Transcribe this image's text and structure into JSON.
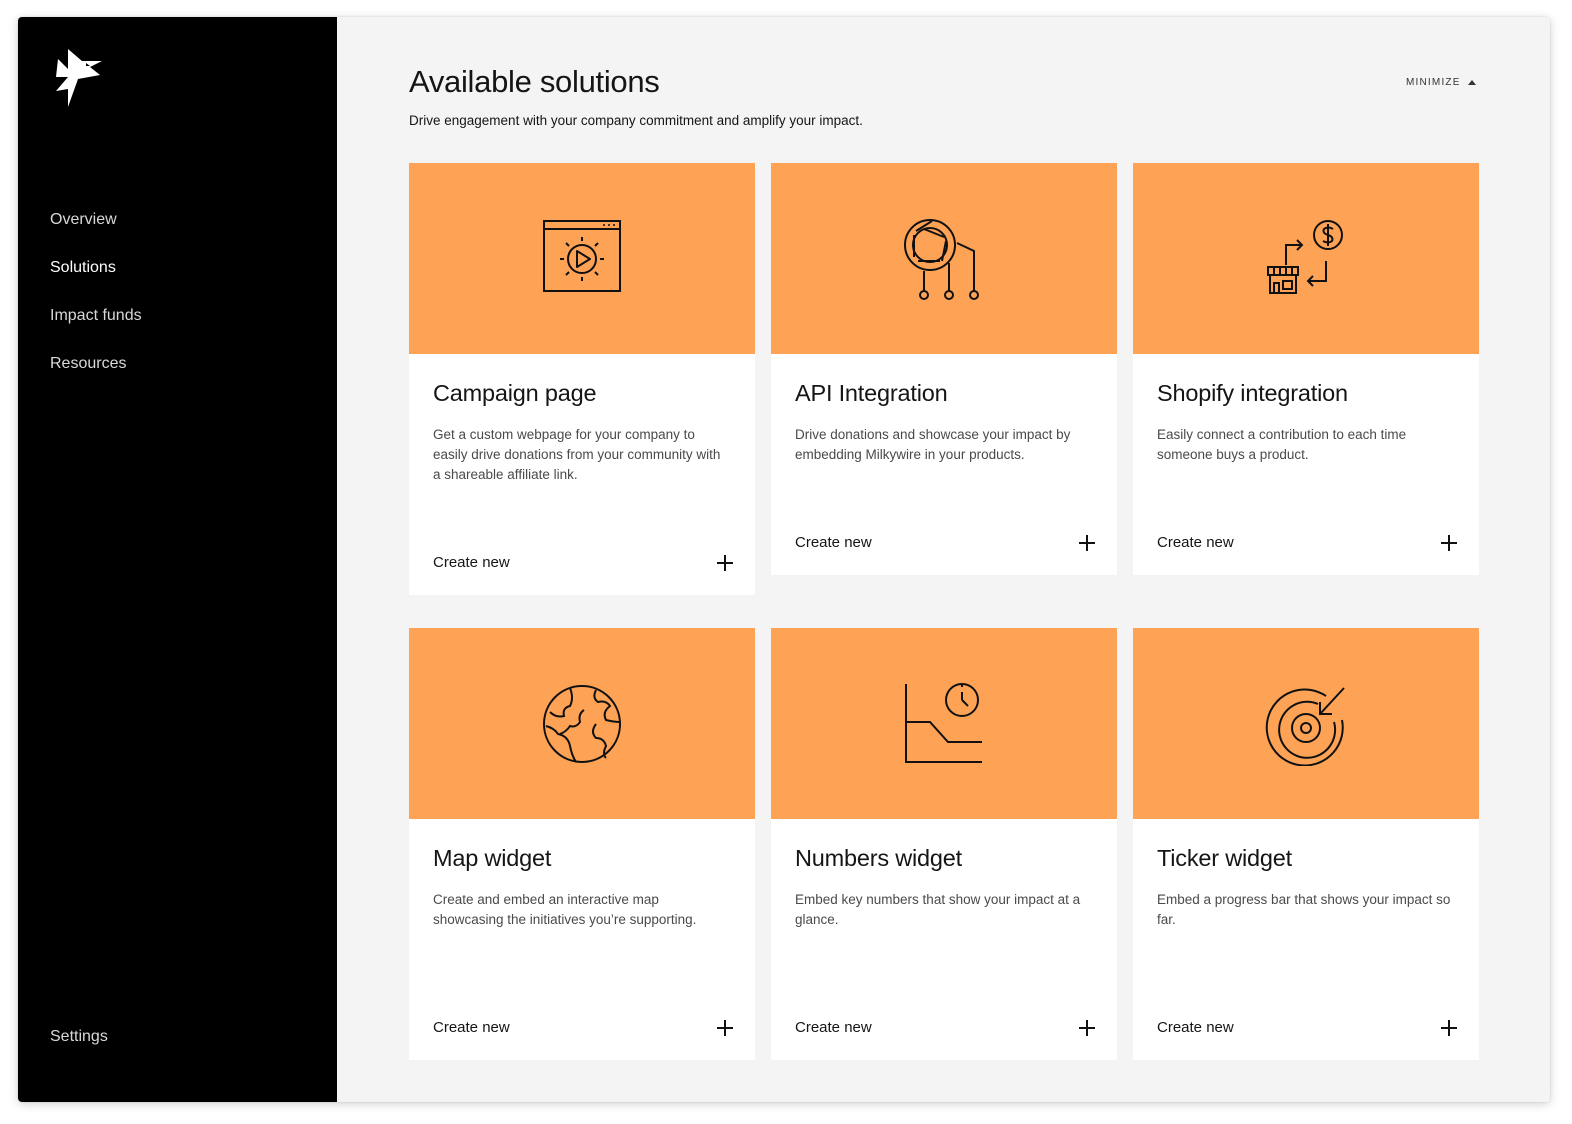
{
  "sidebar": {
    "logo_icon": "bird-logo-icon",
    "items": [
      {
        "label": "Overview"
      },
      {
        "label": "Solutions"
      },
      {
        "label": "Impact funds"
      },
      {
        "label": "Resources"
      }
    ],
    "settings_label": "Settings"
  },
  "header": {
    "title": "Available solutions",
    "subtitle": "Drive engagement with your company commitment and amplify your impact.",
    "minimize_label": "MINIMIZE"
  },
  "colors": {
    "accent": "#fea356",
    "sidebar_bg": "#000000",
    "main_bg": "#f4f4f4"
  },
  "cards": [
    {
      "icon": "video-page-icon",
      "title": "Campaign page",
      "description": "Get a custom webpage for your company to easily drive donations from your community with a shareable affiliate link.",
      "action": "Create new"
    },
    {
      "icon": "api-integration-icon",
      "title": "API Integration",
      "description": "Drive donations and showcase your impact by embedding Milkywire in your products.",
      "action": "Create new"
    },
    {
      "icon": "shop-dollar-icon",
      "title": "Shopify integration",
      "description": "Easily connect a contribution to each time someone buys a product.",
      "action": "Create new"
    },
    {
      "icon": "globe-icon",
      "title": "Map widget",
      "description": "Create and embed an interactive map showcasing the initiatives you’re supporting.",
      "action": "Create new"
    },
    {
      "icon": "chart-clock-icon",
      "title": "Numbers widget",
      "description": "Embed key numbers that show your impact at a glance.",
      "action": "Create new"
    },
    {
      "icon": "target-icon",
      "title": "Ticker widget",
      "description": "Embed a progress bar that shows your impact so far.",
      "action": "Create new"
    }
  ]
}
